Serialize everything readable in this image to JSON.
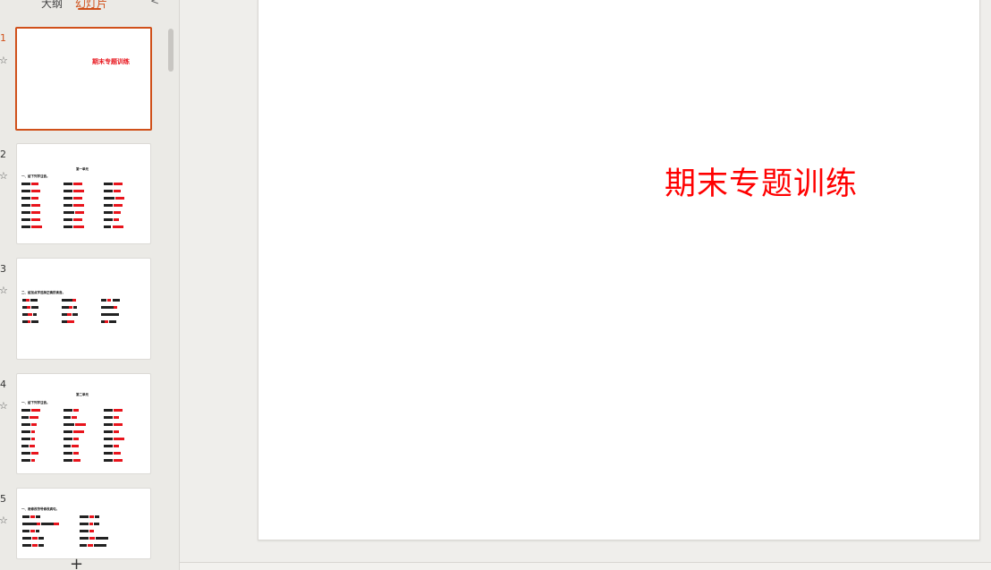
{
  "panel": {
    "tabs": [
      {
        "label": "大纲"
      },
      {
        "label": "幻灯片"
      }
    ],
    "collapse_icon": "chevron-left-icon",
    "add_icon": "plus-icon"
  },
  "slides": [
    {
      "number": "1",
      "title": "期末专题训练",
      "active": true
    },
    {
      "number": "2",
      "heading": "第一单元",
      "subheading": "一、给下列字注音。"
    },
    {
      "number": "3",
      "subheading": "二、给加点字选择正确的读音。"
    },
    {
      "number": "4",
      "heading": "第二单元",
      "subheading": "一、给下列字注音。"
    },
    {
      "number": "5",
      "subheading": "一、用修改符号修改病句。"
    }
  ],
  "editor": {
    "title": "期末专题训练",
    "title_color": "#ff0000"
  },
  "colors": {
    "accent": "#d0501a"
  }
}
